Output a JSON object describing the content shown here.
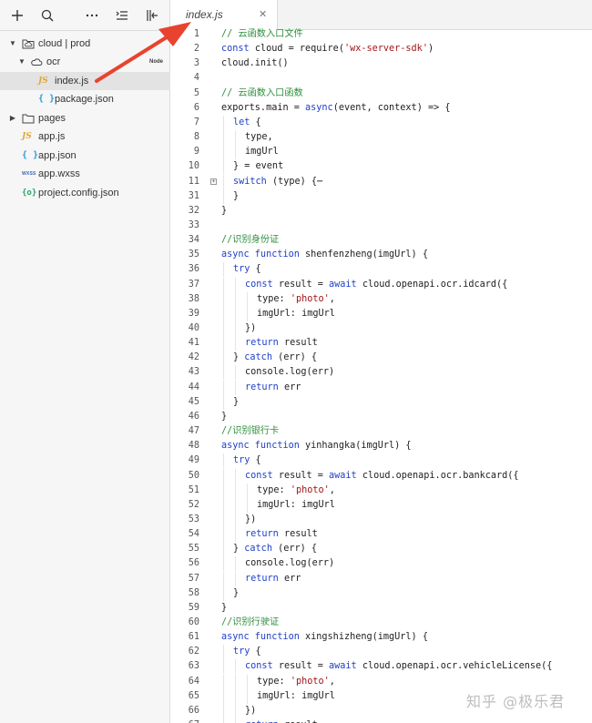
{
  "toolbar": {
    "icons": [
      "plus-icon",
      "search-icon",
      "more-icon",
      "collapse-all-icon",
      "toggle-panel-icon"
    ]
  },
  "tree": [
    {
      "label": "cloud | prod",
      "icon": "cloud-folder-icon",
      "depth": 0,
      "caret": "down"
    },
    {
      "label": "ocr",
      "icon": "cloud-function-icon",
      "depth": 1,
      "caret": "down",
      "badge": "Node"
    },
    {
      "label": "index.js",
      "icon": "js-file-icon",
      "depth": 2,
      "selected": true
    },
    {
      "label": "package.json",
      "icon": "json-file-icon",
      "depth": 2
    },
    {
      "label": "pages",
      "icon": "folder-icon",
      "depth": 0,
      "caret": "right"
    },
    {
      "label": "app.js",
      "icon": "js-file-icon",
      "depth": 0
    },
    {
      "label": "app.json",
      "icon": "json-file-icon",
      "depth": 0
    },
    {
      "label": "app.wxss",
      "icon": "wxss-file-icon",
      "depth": 0
    },
    {
      "label": "project.config.json",
      "icon": "config-file-icon",
      "depth": 0
    }
  ],
  "file_icon_glyphs": {
    "js": "JS",
    "json": "{ }",
    "wxss": "WXSS",
    "config": "{o}"
  },
  "tab": {
    "title": "index.js",
    "close": "✕"
  },
  "code": [
    {
      "n": "1",
      "indent": 0,
      "tokens": [
        [
          "comment",
          "// 云函数入口文件"
        ]
      ]
    },
    {
      "n": "2",
      "indent": 0,
      "tokens": [
        [
          "keyword",
          "const "
        ],
        [
          "plain",
          "cloud = require("
        ],
        [
          "string",
          "'wx-server-sdk'"
        ],
        [
          "plain",
          ")"
        ]
      ]
    },
    {
      "n": "3",
      "indent": 0,
      "tokens": [
        [
          "plain",
          "cloud.init()"
        ]
      ]
    },
    {
      "n": "4",
      "indent": 0,
      "tokens": []
    },
    {
      "n": "5",
      "indent": 0,
      "tokens": [
        [
          "comment",
          "// 云函数入口函数"
        ]
      ]
    },
    {
      "n": "6",
      "indent": 0,
      "tokens": [
        [
          "plain",
          "exports.main = "
        ],
        [
          "keyword",
          "async"
        ],
        [
          "plain",
          "(event, context) => {"
        ]
      ]
    },
    {
      "n": "7",
      "indent": 1,
      "tokens": [
        [
          "keyword",
          "let "
        ],
        [
          "plain",
          "{"
        ]
      ]
    },
    {
      "n": "8",
      "indent": 2,
      "tokens": [
        [
          "plain",
          "type,"
        ]
      ]
    },
    {
      "n": "9",
      "indent": 2,
      "tokens": [
        [
          "plain",
          "imgUrl"
        ]
      ]
    },
    {
      "n": "10",
      "indent": 1,
      "tokens": [
        [
          "plain",
          "} = event"
        ]
      ]
    },
    {
      "n": "11",
      "indent": 1,
      "fold": true,
      "tokens": [
        [
          "keyword",
          "switch "
        ],
        [
          "plain",
          "(type) {⋯"
        ]
      ]
    },
    {
      "n": "31",
      "indent": 1,
      "tokens": [
        [
          "plain",
          "}"
        ]
      ]
    },
    {
      "n": "32",
      "indent": 0,
      "tokens": [
        [
          "plain",
          "}"
        ]
      ]
    },
    {
      "n": "33",
      "indent": 0,
      "tokens": []
    },
    {
      "n": "34",
      "indent": 0,
      "tokens": [
        [
          "comment",
          "//识别身份证"
        ]
      ]
    },
    {
      "n": "35",
      "indent": 0,
      "tokens": [
        [
          "keyword",
          "async function "
        ],
        [
          "plain",
          "shenfenzheng(imgUrl) {"
        ]
      ]
    },
    {
      "n": "36",
      "indent": 1,
      "tokens": [
        [
          "keyword",
          "try "
        ],
        [
          "plain",
          "{"
        ]
      ]
    },
    {
      "n": "37",
      "indent": 2,
      "tokens": [
        [
          "keyword",
          "const "
        ],
        [
          "plain",
          "result = "
        ],
        [
          "keyword",
          "await "
        ],
        [
          "plain",
          "cloud.openapi.ocr.idcard({"
        ]
      ]
    },
    {
      "n": "38",
      "indent": 3,
      "tokens": [
        [
          "plain",
          "type: "
        ],
        [
          "string",
          "'photo'"
        ],
        [
          "plain",
          ","
        ]
      ]
    },
    {
      "n": "39",
      "indent": 3,
      "tokens": [
        [
          "plain",
          "imgUrl: imgUrl"
        ]
      ]
    },
    {
      "n": "40",
      "indent": 2,
      "tokens": [
        [
          "plain",
          "})"
        ]
      ]
    },
    {
      "n": "41",
      "indent": 2,
      "tokens": [
        [
          "keyword",
          "return "
        ],
        [
          "plain",
          "result"
        ]
      ]
    },
    {
      "n": "42",
      "indent": 1,
      "tokens": [
        [
          "plain",
          "} "
        ],
        [
          "keyword",
          "catch "
        ],
        [
          "plain",
          "(err) {"
        ]
      ]
    },
    {
      "n": "43",
      "indent": 2,
      "tokens": [
        [
          "plain",
          "console.log(err)"
        ]
      ]
    },
    {
      "n": "44",
      "indent": 2,
      "tokens": [
        [
          "keyword",
          "return "
        ],
        [
          "plain",
          "err"
        ]
      ]
    },
    {
      "n": "45",
      "indent": 1,
      "tokens": [
        [
          "plain",
          "}"
        ]
      ]
    },
    {
      "n": "46",
      "indent": 0,
      "tokens": [
        [
          "plain",
          "}"
        ]
      ]
    },
    {
      "n": "47",
      "indent": 0,
      "tokens": [
        [
          "comment",
          "//识别银行卡"
        ]
      ]
    },
    {
      "n": "48",
      "indent": 0,
      "tokens": [
        [
          "keyword",
          "async function "
        ],
        [
          "plain",
          "yinhangka(imgUrl) {"
        ]
      ]
    },
    {
      "n": "49",
      "indent": 1,
      "tokens": [
        [
          "keyword",
          "try "
        ],
        [
          "plain",
          "{"
        ]
      ]
    },
    {
      "n": "50",
      "indent": 2,
      "tokens": [
        [
          "keyword",
          "const "
        ],
        [
          "plain",
          "result = "
        ],
        [
          "keyword",
          "await "
        ],
        [
          "plain",
          "cloud.openapi.ocr.bankcard({"
        ]
      ]
    },
    {
      "n": "51",
      "indent": 3,
      "tokens": [
        [
          "plain",
          "type: "
        ],
        [
          "string",
          "'photo'"
        ],
        [
          "plain",
          ","
        ]
      ]
    },
    {
      "n": "52",
      "indent": 3,
      "tokens": [
        [
          "plain",
          "imgUrl: imgUrl"
        ]
      ]
    },
    {
      "n": "53",
      "indent": 2,
      "tokens": [
        [
          "plain",
          "})"
        ]
      ]
    },
    {
      "n": "54",
      "indent": 2,
      "tokens": [
        [
          "keyword",
          "return "
        ],
        [
          "plain",
          "result"
        ]
      ]
    },
    {
      "n": "55",
      "indent": 1,
      "tokens": [
        [
          "plain",
          "} "
        ],
        [
          "keyword",
          "catch "
        ],
        [
          "plain",
          "(err) {"
        ]
      ]
    },
    {
      "n": "56",
      "indent": 2,
      "tokens": [
        [
          "plain",
          "console.log(err)"
        ]
      ]
    },
    {
      "n": "57",
      "indent": 2,
      "tokens": [
        [
          "keyword",
          "return "
        ],
        [
          "plain",
          "err"
        ]
      ]
    },
    {
      "n": "58",
      "indent": 1,
      "tokens": [
        [
          "plain",
          "}"
        ]
      ]
    },
    {
      "n": "59",
      "indent": 0,
      "tokens": [
        [
          "plain",
          "}"
        ]
      ]
    },
    {
      "n": "60",
      "indent": 0,
      "tokens": [
        [
          "comment",
          "//识别行驶证"
        ]
      ]
    },
    {
      "n": "61",
      "indent": 0,
      "tokens": [
        [
          "keyword",
          "async function "
        ],
        [
          "plain",
          "xingshizheng(imgUrl) {"
        ]
      ]
    },
    {
      "n": "62",
      "indent": 1,
      "tokens": [
        [
          "keyword",
          "try "
        ],
        [
          "plain",
          "{"
        ]
      ]
    },
    {
      "n": "63",
      "indent": 2,
      "tokens": [
        [
          "keyword",
          "const "
        ],
        [
          "plain",
          "result = "
        ],
        [
          "keyword",
          "await "
        ],
        [
          "plain",
          "cloud.openapi.ocr.vehicleLicense({"
        ]
      ]
    },
    {
      "n": "64",
      "indent": 3,
      "tokens": [
        [
          "plain",
          "type: "
        ],
        [
          "string",
          "'photo'"
        ],
        [
          "plain",
          ","
        ]
      ]
    },
    {
      "n": "65",
      "indent": 3,
      "tokens": [
        [
          "plain",
          "imgUrl: imgUrl"
        ]
      ]
    },
    {
      "n": "66",
      "indent": 2,
      "tokens": [
        [
          "plain",
          "})"
        ]
      ]
    },
    {
      "n": "67",
      "indent": 2,
      "tokens": [
        [
          "keyword",
          "return "
        ],
        [
          "plain",
          "result"
        ]
      ]
    }
  ],
  "watermark": "知乎 @极乐君",
  "colors": {
    "comment": "#2f8f3f",
    "keyword": "#1f3fc9",
    "string": "#a31515",
    "annotation_arrow": "#e8432f"
  }
}
